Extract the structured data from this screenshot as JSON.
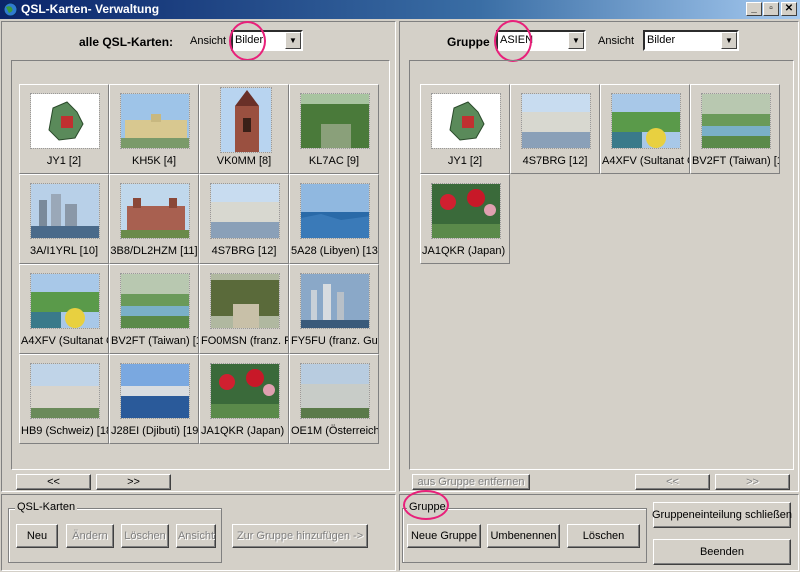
{
  "titlebar": {
    "title": "QSL-Karten- Verwaltung",
    "buttons": [
      "_",
      "▫",
      "✕"
    ]
  },
  "left": {
    "heading": "alle QSL-Karten:",
    "view_label": "Ansicht",
    "view_value": "Bilder",
    "cards": [
      {
        "label": "JY1 [2]",
        "img": "map"
      },
      {
        "label": "KH5K [4]",
        "img": "palace"
      },
      {
        "label": "VK0MM [8]",
        "img": "church"
      },
      {
        "label": "KL7AC [9]",
        "img": "forest"
      },
      {
        "label": "3A/I1YRL [10]",
        "img": "city"
      },
      {
        "label": "3B8/DL2HZM [11]",
        "img": "fort"
      },
      {
        "label": "4S7BRG [12]",
        "img": "coast"
      },
      {
        "label": "5A28 (Libyen) [13]",
        "img": "sea"
      },
      {
        "label": "A4XFV (Sultanat O",
        "img": "garden"
      },
      {
        "label": "BV2FT (Taiwan) [1",
        "img": "river"
      },
      {
        "label": "FO0MSN (franz. P",
        "img": "woods"
      },
      {
        "label": "FY5FU (franz. Guy",
        "img": "skyline"
      },
      {
        "label": "HB9 (Schweiz) [18",
        "img": "town"
      },
      {
        "label": "J28EI (Djibuti) [19]",
        "img": "bay"
      },
      {
        "label": "JA1QKR (Japan) [2",
        "img": "flowers"
      },
      {
        "label": "OE1M (Österreich)",
        "img": "hill"
      }
    ],
    "prev_label": "<<",
    "next_label": ">>"
  },
  "right": {
    "heading": "Gruppe",
    "group_value": "ASIEN",
    "view_label": "Ansicht",
    "view_value": "Bilder",
    "cards": [
      {
        "label": "JY1 [2]",
        "img": "map"
      },
      {
        "label": "4S7BRG [12]",
        "img": "coast"
      },
      {
        "label": "A4XFV (Sultanat O",
        "img": "garden"
      },
      {
        "label": "BV2FT (Taiwan) [1",
        "img": "river"
      },
      {
        "label": "JA1QKR (Japan) [2",
        "img": "flowers"
      }
    ],
    "remove_label": "aus Gruppe entfernen",
    "prev_label": "<<",
    "next_label": ">>"
  },
  "qsl_box": {
    "legend": "QSL-Karten",
    "new_label": "Neu",
    "edit_label": "Ändern",
    "delete_label": "Löschen",
    "view_label": "Ansicht",
    "add_to_group_label": "Zur Gruppe hinzufügen ->"
  },
  "group_box": {
    "legend": "Gruppe",
    "new_group_label": "Neue Gruppe",
    "rename_label": "Umbenennen",
    "delete_label": "Löschen"
  },
  "close_grouping_label": "Gruppeneinteilung schließen",
  "exit_label": "Beenden",
  "colors": {
    "highlight_circle": "#e8207a",
    "titlebar": "#0a246a"
  }
}
